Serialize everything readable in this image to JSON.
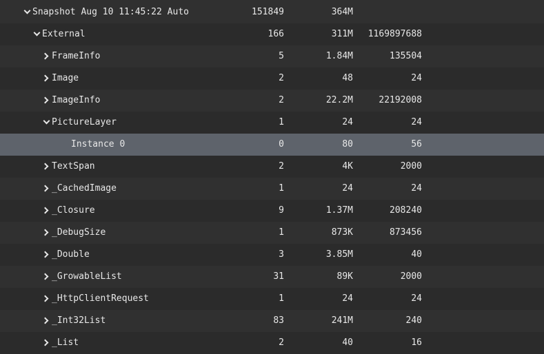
{
  "rows": [
    {
      "depth": 0,
      "expander": "down",
      "label": "Snapshot Aug 10 11:45:22 Auto",
      "count": "151849",
      "shallow": "364M",
      "retained": "",
      "selected": false
    },
    {
      "depth": 1,
      "expander": "down",
      "label": "External",
      "count": "166",
      "shallow": "311M",
      "retained": "1169897688",
      "selected": false
    },
    {
      "depth": 2,
      "expander": "right",
      "label": "FrameInfo",
      "count": "5",
      "shallow": "1.84M",
      "retained": "135504",
      "selected": false
    },
    {
      "depth": 2,
      "expander": "right",
      "label": "Image",
      "count": "2",
      "shallow": "48",
      "retained": "24",
      "selected": false
    },
    {
      "depth": 2,
      "expander": "right",
      "label": "ImageInfo",
      "count": "2",
      "shallow": "22.2M",
      "retained": "22192008",
      "selected": false
    },
    {
      "depth": 2,
      "expander": "down",
      "label": "PictureLayer",
      "count": "1",
      "shallow": "24",
      "retained": "24",
      "selected": false
    },
    {
      "depth": 3,
      "expander": "none",
      "label": "Instance 0",
      "count": "0",
      "shallow": "80",
      "retained": "56",
      "selected": true
    },
    {
      "depth": 2,
      "expander": "right",
      "label": "TextSpan",
      "count": "2",
      "shallow": "4K",
      "retained": "2000",
      "selected": false
    },
    {
      "depth": 2,
      "expander": "right",
      "label": "_CachedImage",
      "count": "1",
      "shallow": "24",
      "retained": "24",
      "selected": false
    },
    {
      "depth": 2,
      "expander": "right",
      "label": "_Closure",
      "count": "9",
      "shallow": "1.37M",
      "retained": "208240",
      "selected": false
    },
    {
      "depth": 2,
      "expander": "right",
      "label": "_DebugSize",
      "count": "1",
      "shallow": "873K",
      "retained": "873456",
      "selected": false
    },
    {
      "depth": 2,
      "expander": "right",
      "label": "_Double",
      "count": "3",
      "shallow": "3.85M",
      "retained": "40",
      "selected": false
    },
    {
      "depth": 2,
      "expander": "right",
      "label": "_GrowableList",
      "count": "31",
      "shallow": "89K",
      "retained": "2000",
      "selected": false
    },
    {
      "depth": 2,
      "expander": "right",
      "label": "_HttpClientRequest",
      "count": "1",
      "shallow": "24",
      "retained": "24",
      "selected": false
    },
    {
      "depth": 2,
      "expander": "right",
      "label": "_Int32List",
      "count": "83",
      "shallow": "241M",
      "retained": "240",
      "selected": false
    },
    {
      "depth": 2,
      "expander": "right",
      "label": "_List",
      "count": "2",
      "shallow": "40",
      "retained": "16",
      "selected": false
    }
  ]
}
